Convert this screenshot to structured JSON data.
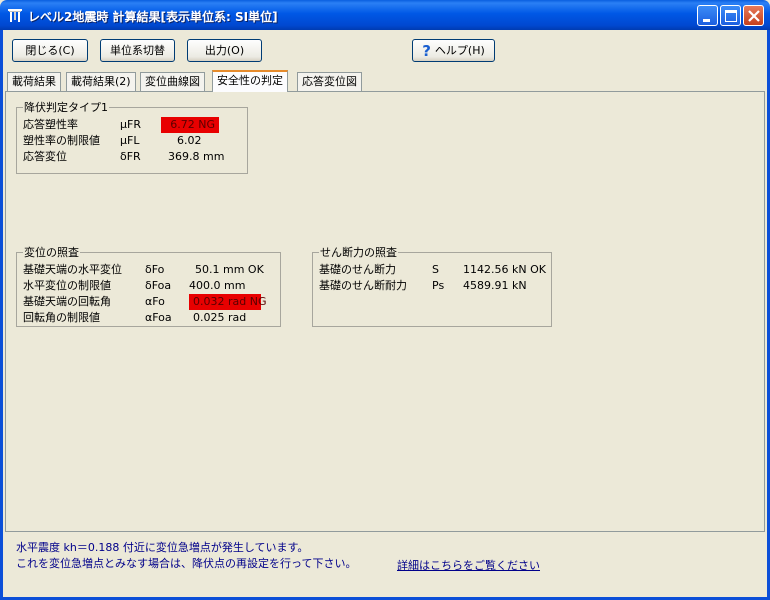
{
  "window": {
    "title": "レベル2地震時  計算結果[表示単位系: SI単位]"
  },
  "toolbar": {
    "close_label": "閉じる(C)",
    "units_label": "単位系切替",
    "output_label": "出力(O)",
    "help_label": "ヘルプ(H)"
  },
  "tabs": [
    {
      "label": "載荷結果"
    },
    {
      "label": "載荷結果(2)"
    },
    {
      "label": "変位曲線図"
    },
    {
      "label": "安全性の判定"
    },
    {
      "label": "応答変位図"
    }
  ],
  "yield_group": {
    "title": "降伏判定タイプ1",
    "rows": [
      {
        "label": "応答塑性率",
        "symbol": "μFR",
        "value": "6.72  NG",
        "status": "NG"
      },
      {
        "label": "塑性率の制限値",
        "symbol": "μFL",
        "value": "6.02"
      },
      {
        "label": "応答変位",
        "symbol": "δFR",
        "value": "369.8   mm"
      }
    ]
  },
  "disp_group": {
    "title": "変位の照査",
    "rows": [
      {
        "label": "基礎天端の水平変位",
        "symbol": "δFo",
        "value": "50.1  mm OK"
      },
      {
        "label": "水平変位の制限値",
        "symbol": "δFoa",
        "value": "400.0  mm"
      },
      {
        "label": "基礎天端の回転角",
        "symbol": "αFo",
        "value": "0.032  rad NG",
        "status": "NG"
      },
      {
        "label": "回転角の制限値",
        "symbol": "αFoa",
        "value": "0.025  rad"
      }
    ]
  },
  "shear_group": {
    "title": "せん断力の照査",
    "rows": [
      {
        "label": "基礎のせん断力",
        "symbol": "S",
        "value": "1142.56  kN OK"
      },
      {
        "label": "基礎のせん断耐力",
        "symbol": "Ps",
        "value": "4589.91  kN"
      }
    ]
  },
  "status": {
    "line1": "水平震度 kh＝0.188 付近に変位急増点が発生しています。",
    "line2": "これを変位急増点とみなす場合は、降伏点の再設定を行って下さい。",
    "link": "詳細はこちらをご覧ください"
  },
  "colors": {
    "titlebar": "#0058e6",
    "ng_highlight": "#e80000",
    "status_text": "#00008a",
    "active_tab_accent": "#e68b2c"
  }
}
